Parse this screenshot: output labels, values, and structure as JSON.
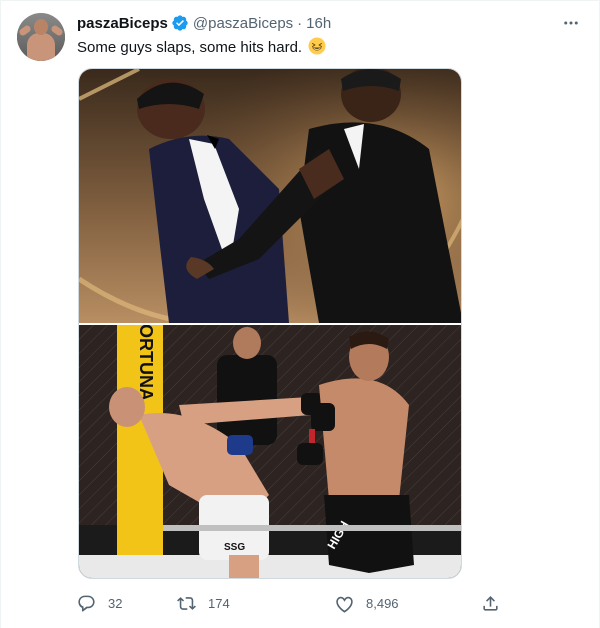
{
  "tweet": {
    "author_name": "paszaBiceps",
    "author_handle": "@paszaBiceps",
    "separator": "·",
    "time": "16h",
    "text": "Some guys slaps, some hits hard.",
    "emoji": "grinning-squinting-face",
    "verified": true
  },
  "media": {
    "image_1": {
      "banner_text": ""
    },
    "image_2": {
      "banner_text": "RTUN ORTUNA",
      "shorts_text": "SSG",
      "shorts_text_2": "HIGH"
    }
  },
  "actions": {
    "reply_count": "32",
    "retweet_count": "174",
    "like_count": "8,496"
  },
  "colors": {
    "text_primary": "#0f1419",
    "text_secondary": "#536471",
    "verified_blue": "#1d9bf0",
    "border": "#cfd9de",
    "banner_yellow": "#f2c418"
  }
}
